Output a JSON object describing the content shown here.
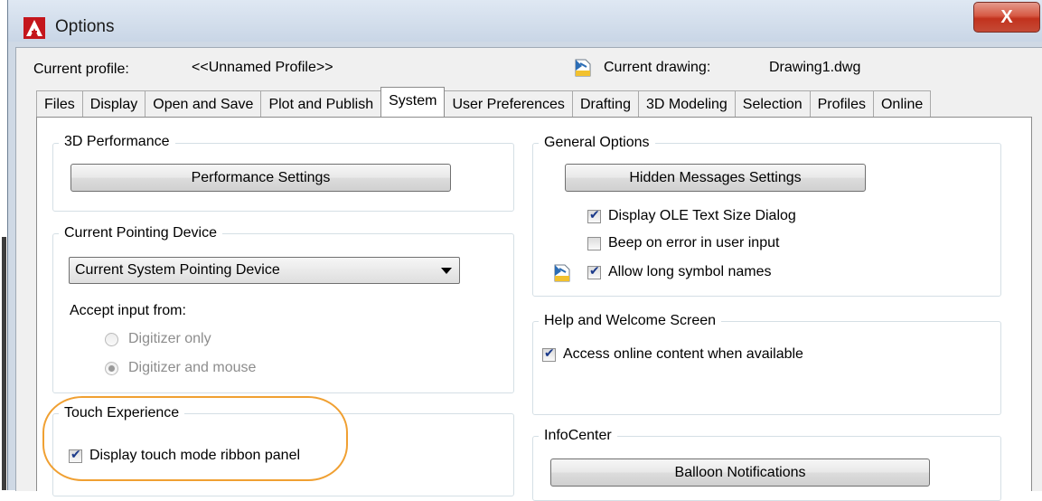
{
  "window": {
    "title": "Options",
    "close_glyph": "X",
    "app_icon": "autocad-logo-icon",
    "accent_close": "#c8381f"
  },
  "header": {
    "profile_label": "Current profile:",
    "profile_value": "<<Unnamed Profile>>",
    "drawing_label": "Current drawing:",
    "drawing_value": "Drawing1.dwg",
    "drawing_icon": "drawing-file-icon"
  },
  "tabs": [
    {
      "label": "Files"
    },
    {
      "label": "Display"
    },
    {
      "label": "Open and Save"
    },
    {
      "label": "Plot and Publish"
    },
    {
      "label": "System",
      "active": true
    },
    {
      "label": "User Preferences"
    },
    {
      "label": "Drafting"
    },
    {
      "label": "3D Modeling"
    },
    {
      "label": "Selection"
    },
    {
      "label": "Profiles"
    },
    {
      "label": "Online"
    }
  ],
  "performance": {
    "title": "3D Performance",
    "button": "Performance Settings"
  },
  "pointing": {
    "title": "Current Pointing Device",
    "selected": "Current System Pointing Device",
    "accept_label": "Accept input from:",
    "options": [
      {
        "label": "Digitizer only",
        "selected": false
      },
      {
        "label": "Digitizer and mouse",
        "selected": true
      }
    ]
  },
  "touch": {
    "title": "Touch Experience",
    "checkbox_label": "Display touch mode ribbon panel",
    "checked": true,
    "highlight_color": "#f0a032"
  },
  "general": {
    "title": "General Options",
    "button": "Hidden Messages Settings",
    "checkboxes": [
      {
        "label": "Display OLE Text Size Dialog",
        "checked": true
      },
      {
        "label": "Beep on error in user input",
        "checked": false
      },
      {
        "label": "Allow long symbol names",
        "checked": true
      }
    ]
  },
  "help": {
    "title": "Help and Welcome Screen",
    "checkbox_label": "Access online content when available",
    "checked": true
  },
  "infocenter": {
    "title": "InfoCenter",
    "button": "Balloon Notifications"
  }
}
